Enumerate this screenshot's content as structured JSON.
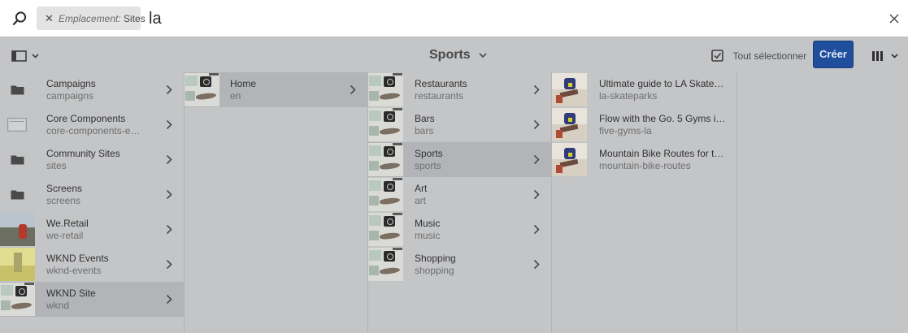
{
  "search": {
    "tag_key": "Emplacement:",
    "tag_value": "Sites",
    "query": "la"
  },
  "toolbar": {
    "title": "Sports",
    "select_all_label": "Tout sélectionner",
    "create_label": "Créer"
  },
  "columns": [
    {
      "items": [
        {
          "title": "Campaigns",
          "name": "campaigns",
          "thumb": "folder-icon",
          "selected": false
        },
        {
          "title": "Core Components",
          "name": "core-components-exa...",
          "thumb": "component-icon",
          "selected": false
        },
        {
          "title": "Community Sites",
          "name": "sites",
          "thumb": "folder-icon",
          "selected": false
        },
        {
          "title": "Screens",
          "name": "screens",
          "thumb": "folder-icon",
          "selected": false
        },
        {
          "title": "We.Retail",
          "name": "we-retail",
          "thumb": "retail-thumbnail",
          "selected": false
        },
        {
          "title": "WKND Events",
          "name": "wknd-events",
          "thumb": "events-thumbnail",
          "selected": false
        },
        {
          "title": "WKND Site",
          "name": "wknd",
          "thumb": "site-thumbnail",
          "selected": true
        }
      ]
    },
    {
      "items": [
        {
          "title": "Home",
          "name": "en",
          "thumb": "site-thumbnail",
          "selected": true
        }
      ]
    },
    {
      "items": [
        {
          "title": "Restaurants",
          "name": "restaurants",
          "thumb": "site-thumbnail",
          "selected": false
        },
        {
          "title": "Bars",
          "name": "bars",
          "thumb": "site-thumbnail",
          "selected": false
        },
        {
          "title": "Sports",
          "name": "sports",
          "thumb": "site-thumbnail",
          "selected": true
        },
        {
          "title": "Art",
          "name": "art",
          "thumb": "site-thumbnail",
          "selected": false
        },
        {
          "title": "Music",
          "name": "music",
          "thumb": "site-thumbnail",
          "selected": false
        },
        {
          "title": "Shopping",
          "name": "shopping",
          "thumb": "site-thumbnail",
          "selected": false
        }
      ]
    },
    {
      "items": [
        {
          "title": "Ultimate guide to LA Skateparks.",
          "name": "la-skateparks",
          "thumb": "skate-thumbnail",
          "selected": false
        },
        {
          "title": "Flow with the Go. 5 Gyms in LA.",
          "name": "five-gyms-la",
          "thumb": "skate-thumbnail",
          "selected": false
        },
        {
          "title": "Mountain Bike Routes for the ...",
          "name": "mountain-bike-routes",
          "thumb": "skate-thumbnail",
          "selected": false
        }
      ]
    }
  ],
  "colors": {
    "accent": "#1f4f9c",
    "overlay": "#c4c5c7",
    "selected_row": "#b2b4b8"
  }
}
